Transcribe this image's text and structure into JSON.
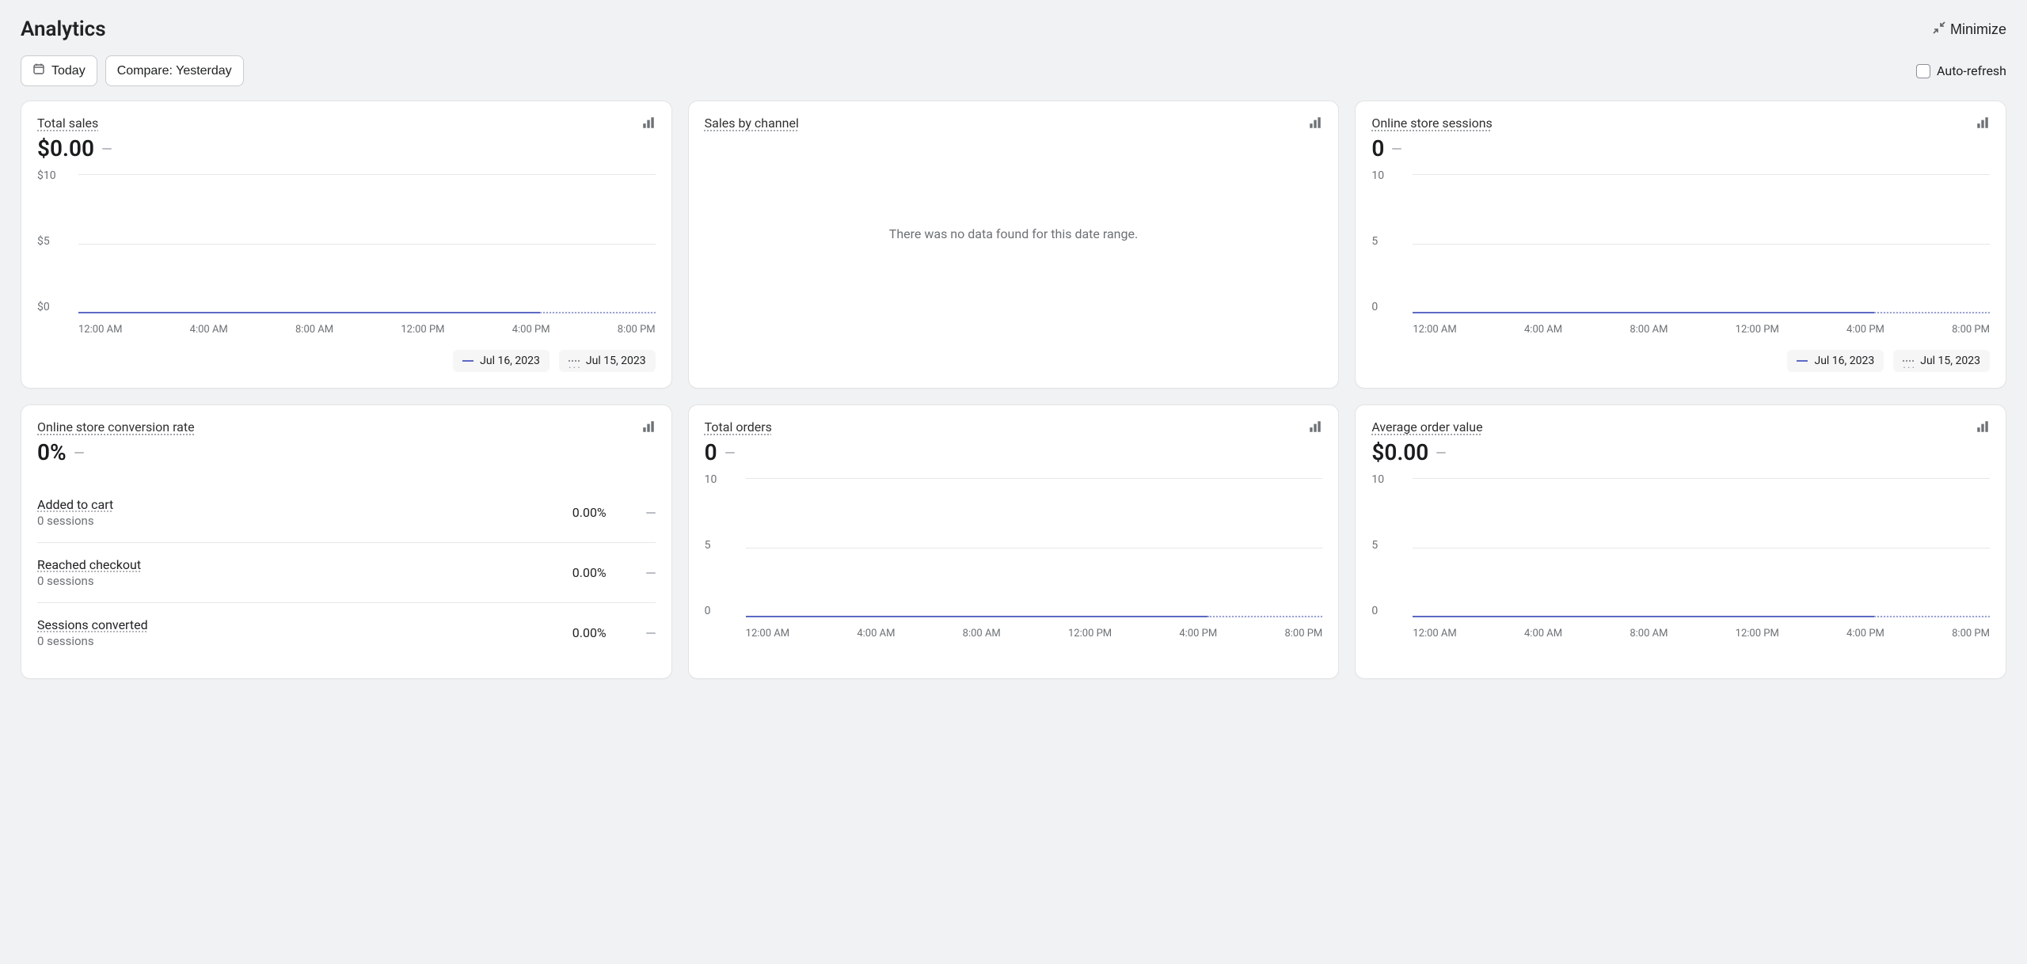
{
  "header": {
    "title": "Analytics",
    "minimize_label": "Minimize"
  },
  "controls": {
    "date_range_label": "Today",
    "compare_label": "Compare: Yesterday",
    "auto_refresh_label": "Auto-refresh"
  },
  "legend": {
    "current": "Jul 16, 2023",
    "previous": "Jul 15, 2023"
  },
  "x_ticks": [
    "12:00 AM",
    "4:00 AM",
    "8:00 AM",
    "12:00 PM",
    "4:00 PM",
    "8:00 PM"
  ],
  "cards": {
    "total_sales": {
      "title": "Total sales",
      "value": "$0.00",
      "y_ticks": [
        "$10",
        "$5",
        "$0"
      ]
    },
    "sales_by_channel": {
      "title": "Sales by channel",
      "empty_message": "There was no data found for this date range."
    },
    "sessions": {
      "title": "Online store sessions",
      "value": "0",
      "y_ticks": [
        "10",
        "5",
        "0"
      ]
    },
    "conversion": {
      "title": "Online store conversion rate",
      "value": "0%",
      "steps": [
        {
          "label": "Added to cart",
          "sessions": "0 sessions",
          "pct": "0.00%"
        },
        {
          "label": "Reached checkout",
          "sessions": "0 sessions",
          "pct": "0.00%"
        },
        {
          "label": "Sessions converted",
          "sessions": "0 sessions",
          "pct": "0.00%"
        }
      ]
    },
    "total_orders": {
      "title": "Total orders",
      "value": "0",
      "y_ticks": [
        "10",
        "5",
        "0"
      ]
    },
    "avg_order_value": {
      "title": "Average order value",
      "value": "$0.00",
      "y_ticks": [
        "10",
        "5",
        "0"
      ]
    }
  },
  "chart_data": [
    {
      "type": "line",
      "title": "Total sales",
      "x": [
        "12:00 AM",
        "4:00 AM",
        "8:00 AM",
        "12:00 PM",
        "4:00 PM",
        "8:00 PM"
      ],
      "series": [
        {
          "name": "Jul 16, 2023",
          "values": [
            0,
            0,
            0,
            0,
            0,
            0
          ]
        },
        {
          "name": "Jul 15, 2023",
          "values": [
            0,
            0,
            0,
            0,
            0,
            0
          ]
        }
      ],
      "ylabel": "$",
      "ylim": [
        0,
        10
      ]
    },
    {
      "type": "line",
      "title": "Online store sessions",
      "x": [
        "12:00 AM",
        "4:00 AM",
        "8:00 AM",
        "12:00 PM",
        "4:00 PM",
        "8:00 PM"
      ],
      "series": [
        {
          "name": "Jul 16, 2023",
          "values": [
            0,
            0,
            0,
            0,
            0,
            0
          ]
        },
        {
          "name": "Jul 15, 2023",
          "values": [
            0,
            0,
            0,
            0,
            0,
            0
          ]
        }
      ],
      "ylim": [
        0,
        10
      ]
    },
    {
      "type": "table",
      "title": "Online store conversion rate",
      "rows": [
        {
          "step": "Added to cart",
          "sessions": 0,
          "pct": 0.0
        },
        {
          "step": "Reached checkout",
          "sessions": 0,
          "pct": 0.0
        },
        {
          "step": "Sessions converted",
          "sessions": 0,
          "pct": 0.0
        }
      ]
    },
    {
      "type": "line",
      "title": "Total orders",
      "x": [
        "12:00 AM",
        "4:00 AM",
        "8:00 AM",
        "12:00 PM",
        "4:00 PM",
        "8:00 PM"
      ],
      "series": [
        {
          "name": "Jul 16, 2023",
          "values": [
            0,
            0,
            0,
            0,
            0,
            0
          ]
        },
        {
          "name": "Jul 15, 2023",
          "values": [
            0,
            0,
            0,
            0,
            0,
            0
          ]
        }
      ],
      "ylim": [
        0,
        10
      ]
    },
    {
      "type": "line",
      "title": "Average order value",
      "x": [
        "12:00 AM",
        "4:00 AM",
        "8:00 AM",
        "12:00 PM",
        "4:00 PM",
        "8:00 PM"
      ],
      "series": [
        {
          "name": "Jul 16, 2023",
          "values": [
            0,
            0,
            0,
            0,
            0,
            0
          ]
        },
        {
          "name": "Jul 15, 2023",
          "values": [
            0,
            0,
            0,
            0,
            0,
            0
          ]
        }
      ],
      "ylim": [
        0,
        10
      ]
    }
  ]
}
